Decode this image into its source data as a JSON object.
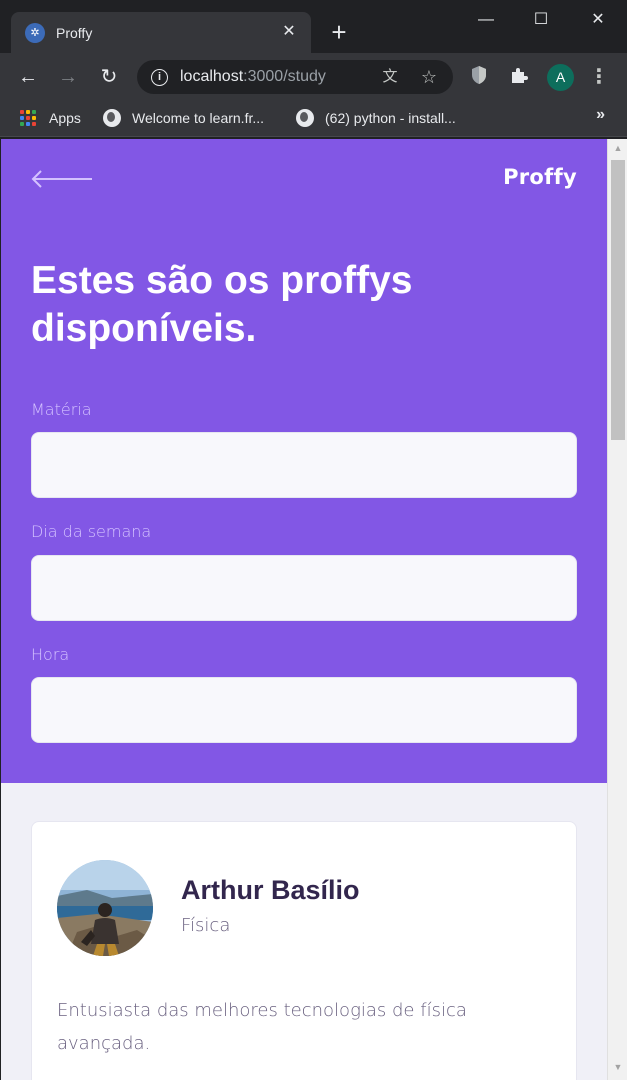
{
  "browser": {
    "tab_title": "Proffy",
    "url_host": "localhost",
    "url_path": ":3000/study",
    "profile_initial": "A",
    "bookmarks": [
      {
        "label": "Apps"
      },
      {
        "label": "Welcome to learn.fr..."
      },
      {
        "label": "(62) python - install..."
      }
    ],
    "more_label": "»"
  },
  "page": {
    "logo": "Proffy",
    "title": "Estes são os proffys disponíveis.",
    "fields": {
      "subject_label": "Matéria",
      "weekday_label": "Dia da semana",
      "time_label": "Hora",
      "subject_value": "",
      "weekday_value": "",
      "time_value": ""
    },
    "colors": {
      "primary": "#8257e5",
      "background": "#f0f0f7",
      "title_text": "#32264d",
      "body_text": "#6a6180"
    }
  },
  "teachers": [
    {
      "name": "Arthur Basílio",
      "subject": "Física",
      "bio": "Entusiasta das melhores tecnologias de física avançada."
    }
  ]
}
